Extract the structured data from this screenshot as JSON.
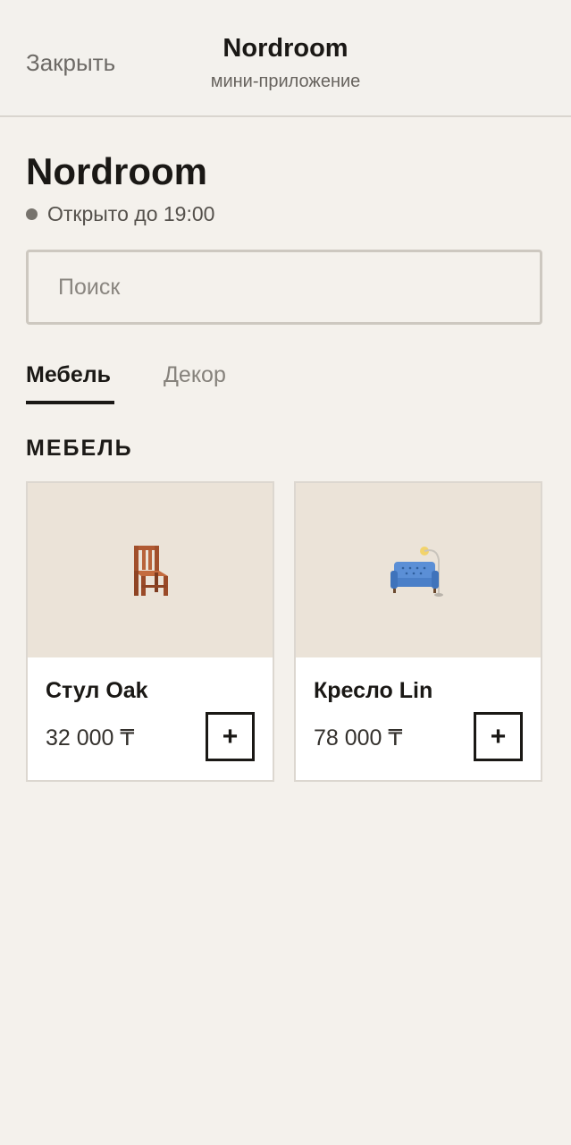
{
  "header": {
    "close_label": "Закрыть",
    "title": "Nordroom",
    "subtitle": "мини-приложение"
  },
  "store": {
    "name": "Nordroom",
    "status": "Открыто до 19:00"
  },
  "search": {
    "placeholder": "Поиск",
    "value": ""
  },
  "tabs": [
    {
      "label": "Мебель",
      "active": true
    },
    {
      "label": "Декор",
      "active": false
    }
  ],
  "section": {
    "heading": "МЕБЕЛЬ"
  },
  "products": [
    {
      "name": "Стул Oak",
      "price": "32 000 ₸",
      "icon": "chair-icon",
      "add_label": "+"
    },
    {
      "name": "Кресло Lin",
      "price": "78 000 ₸",
      "icon": "sofa-icon",
      "add_label": "+"
    }
  ],
  "colors": {
    "background": "#f4f1ec",
    "card_image_bg": "#ebe3d8",
    "accent": "#1a1815"
  }
}
